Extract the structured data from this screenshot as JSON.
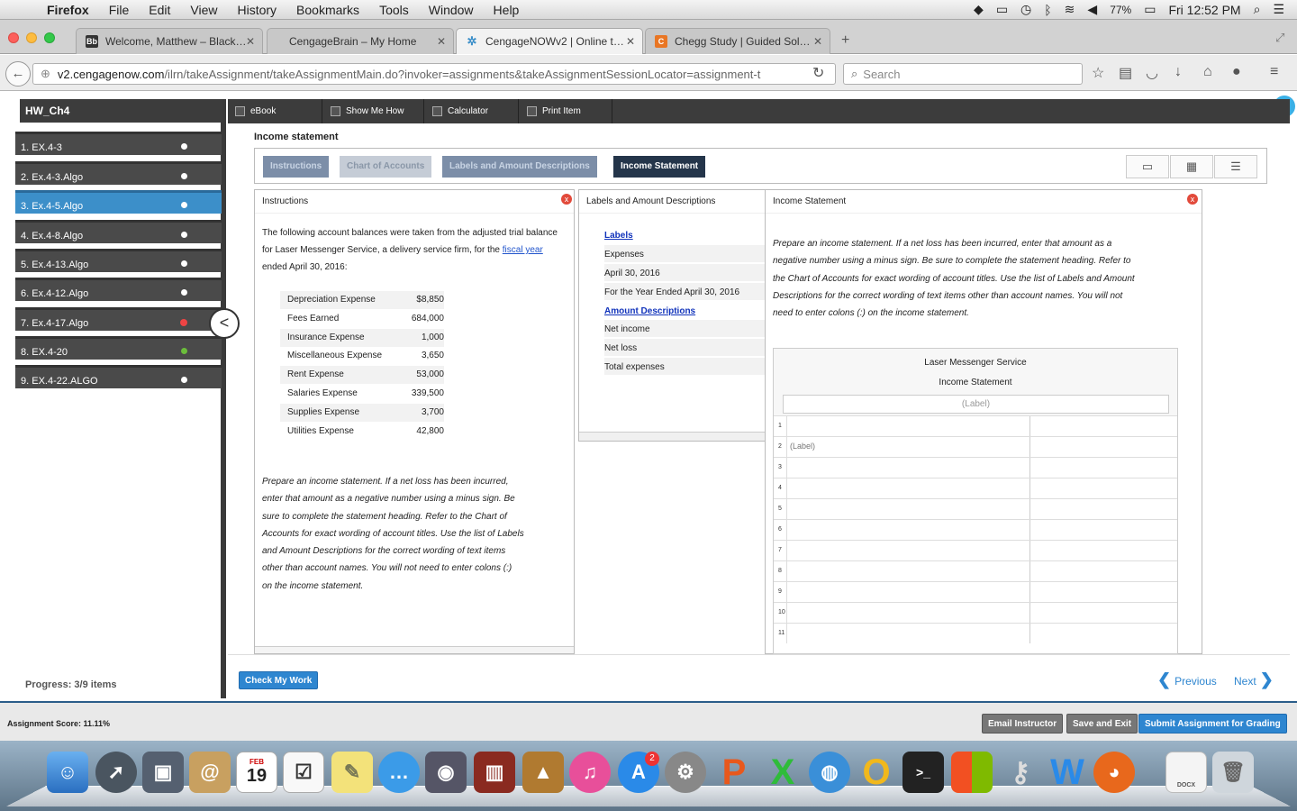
{
  "menubar": {
    "app": "Firefox",
    "items": [
      "File",
      "Edit",
      "View",
      "History",
      "Bookmarks",
      "Tools",
      "Window",
      "Help"
    ],
    "battery": "77%",
    "clock": "Fri 12:52 PM"
  },
  "tabs": [
    {
      "label": "Welcome, Matthew – Black…",
      "icon": "Bb",
      "color": "#333333"
    },
    {
      "label": "CengageBrain – My Home",
      "icon": "",
      "color": "#c8c8c8"
    },
    {
      "label": "CengageNOWv2 | Online t…",
      "icon": "✲",
      "color": "#3c8fc9"
    },
    {
      "label": "Chegg Study | Guided Sol…",
      "icon": "C",
      "color": "#e97624"
    }
  ],
  "nav": {
    "url_domain": "v2.cengagenow.com",
    "url_path": "/ilrn/takeAssignment/takeAssignmentMain.do?invoker=assignments&takeAssignmentSessionLocator=assignment-t",
    "search_placeholder": "Search"
  },
  "sidebar": {
    "title": "HW_Ch4",
    "items": [
      {
        "label": "1. EX.4-3",
        "status": "dot"
      },
      {
        "label": "2. Ex.4-3.Algo",
        "status": "dot"
      },
      {
        "label": "3. Ex.4-5.Algo",
        "status": "dot"
      },
      {
        "label": "4. Ex.4-8.Algo",
        "status": "dot"
      },
      {
        "label": "5. Ex.4-13.Algo",
        "status": "dot"
      },
      {
        "label": "6. Ex.4-12.Algo",
        "status": "dot"
      },
      {
        "label": "7. Ex.4-17.Algo",
        "status": "x"
      },
      {
        "label": "8. EX.4-20",
        "status": "ok"
      },
      {
        "label": "9. EX.4-22.ALGO",
        "status": "dot"
      }
    ],
    "selected_index": 2,
    "progress": "Progress:  3/9 items"
  },
  "toolbar": {
    "ebook": "eBook",
    "show_me_how": "Show Me How",
    "calculator": "Calculator",
    "print_item": "Print Item"
  },
  "item_title": "Income statement",
  "subtabs": [
    "Instructions",
    "Chart of Accounts",
    "Labels and Amount Descriptions",
    "Income Statement"
  ],
  "active_subtab": 3,
  "instructions": {
    "header": "Instructions",
    "intro_before": "The following account balances were taken from the adjusted trial balance for Laser Messenger Service, a delivery service firm, for the ",
    "intro_link": "fiscal year",
    "intro_after": " ended April 30, 2016:",
    "accounts": [
      {
        "name": "Depreciation Expense",
        "value": "$8,850"
      },
      {
        "name": "Fees Earned",
        "value": "684,000"
      },
      {
        "name": "Insurance Expense",
        "value": "1,000"
      },
      {
        "name": "Miscellaneous Expense",
        "value": "3,650"
      },
      {
        "name": "Rent Expense",
        "value": "53,000"
      },
      {
        "name": "Salaries Expense",
        "value": "339,500"
      },
      {
        "name": "Supplies Expense",
        "value": "3,700"
      },
      {
        "name": "Utilities Expense",
        "value": "42,800"
      }
    ],
    "prompt_lines": [
      "Prepare an income statement. If a net loss has been incurred,",
      "enter that amount as a negative number using a minus sign. Be",
      "sure to complete the statement heading. Refer to the Chart of",
      "Accounts for exact wording of account titles. Use the list of Labels",
      "and Amount Descriptions for the correct wording of text items",
      "other than account names. You will not need to enter colons (:)",
      "on the income statement."
    ]
  },
  "labels_panel": {
    "header": "Labels and Amount Descriptions",
    "labels_title": "Labels",
    "labels": [
      "Expenses",
      "April 30, 2016",
      "For the Year Ended April 30, 2016"
    ],
    "amounts_title": "Amount Descriptions",
    "amounts": [
      "Net income",
      "Net loss",
      "Total expenses"
    ]
  },
  "income_statement": {
    "header": "Income Statement",
    "prompt_lines": [
      "Prepare an income statement. If a net loss has been incurred, enter that amount as a",
      "negative number using a minus sign. Be sure to complete the statement heading. Refer to",
      "the Chart of Accounts for exact wording of account titles. Use the list of Labels and Amount",
      "Descriptions for the correct wording of text items other than account names. You will not",
      "need to enter colons (:) on the income statement."
    ],
    "company": "Laser Messenger Service",
    "statement": "Income Statement",
    "heading_placeholder": "(Label)",
    "row_numbers": [
      "1",
      "2",
      "3",
      "4",
      "5",
      "6",
      "7",
      "8",
      "9",
      "10",
      "11"
    ],
    "row2_placeholder": "(Label)"
  },
  "footer": {
    "check": "Check My Work",
    "previous": "Previous",
    "next": "Next",
    "score": "Assignment Score: 11.11%",
    "email": "Email Instructor",
    "save": "Save and Exit",
    "submit": "Submit Assignment for Grading"
  },
  "dock": {
    "calendar_month": "FEB",
    "calendar_day": "19",
    "appstore_badge": "2",
    "docx_label": "DOCX"
  }
}
